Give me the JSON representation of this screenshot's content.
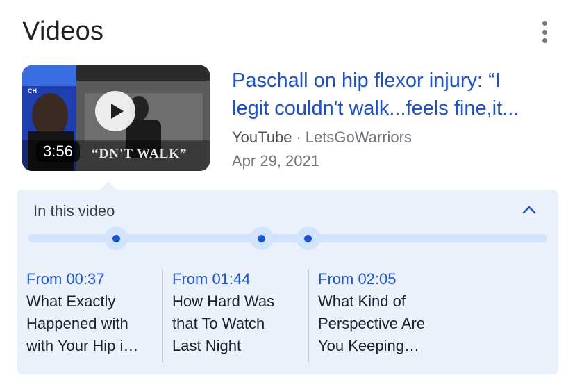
{
  "section": {
    "title": "Videos",
    "menu_icon": "more-vert-icon"
  },
  "video": {
    "thumbnail_text": "“DN'T WALK”",
    "thumbnail_tag": "CH",
    "duration": "3:56",
    "title_line1": "Paschall on hip flexor injury: “I",
    "title_line2": "legit couldn't walk...feels fine,it...",
    "source": "YouTube",
    "separator": "·",
    "channel": "LetsGoWarriors",
    "date": "Apr 29, 2021"
  },
  "in_this_video": {
    "title": "In this video",
    "collapse_icon": "chevron-up-icon",
    "progress_markers": [
      0.17,
      0.45,
      0.54
    ],
    "chapters": [
      {
        "from": "From 00:37",
        "line1": "What Exactly",
        "line2": "Happened with",
        "line3": "with Your Hip i…"
      },
      {
        "from": "From 01:44",
        "line1": "How Hard Was",
        "line2": "that To Watch",
        "line3": "Last Night"
      },
      {
        "from": "From 02:05",
        "line1": "What Kind of",
        "line2": "Perspective Are",
        "line3": "You Keeping…"
      }
    ]
  },
  "colors": {
    "link": "#1a56db",
    "panel": "#eaf1fb",
    "track": "#d2e3fc",
    "text": "#202124",
    "muted": "#70757a"
  }
}
